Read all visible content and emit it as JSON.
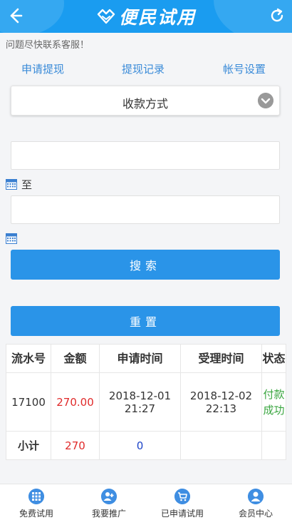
{
  "header": {
    "title": "便民试用",
    "back_icon": "back-arrow-icon",
    "refresh_icon": "refresh-icon",
    "logo_icon": "handshake-logo-icon",
    "color": "#1a9cf0"
  },
  "notice": "问题尽快联系客服！",
  "tabs": [
    {
      "label": "申请提现"
    },
    {
      "label": "提现记录"
    },
    {
      "label": "帐号设置"
    }
  ],
  "filter": {
    "payment_method": "收款方式",
    "to_label": "至",
    "search_button": "搜索",
    "reset_button": "重置",
    "button_color": "#2a94e8"
  },
  "table": {
    "headers": [
      "流水号",
      "金额",
      "申请时间",
      "受理时间",
      "状态"
    ],
    "rows": [
      {
        "serial": "17100",
        "amount": "270.00",
        "apply_date": "2018-12-01",
        "apply_time": "21:27",
        "accept_date": "2018-12-02",
        "accept_time": "22:13",
        "status": "付款成功"
      }
    ],
    "subtotal": {
      "label": "小计",
      "amount": "270",
      "count": "0"
    }
  },
  "bottom_nav": [
    {
      "label": "免费试用",
      "icon": "grid-icon"
    },
    {
      "label": "我要推广",
      "icon": "add-user-icon"
    },
    {
      "label": "已申请试用",
      "icon": "cart-icon"
    },
    {
      "label": "会员中心",
      "icon": "user-icon"
    }
  ]
}
